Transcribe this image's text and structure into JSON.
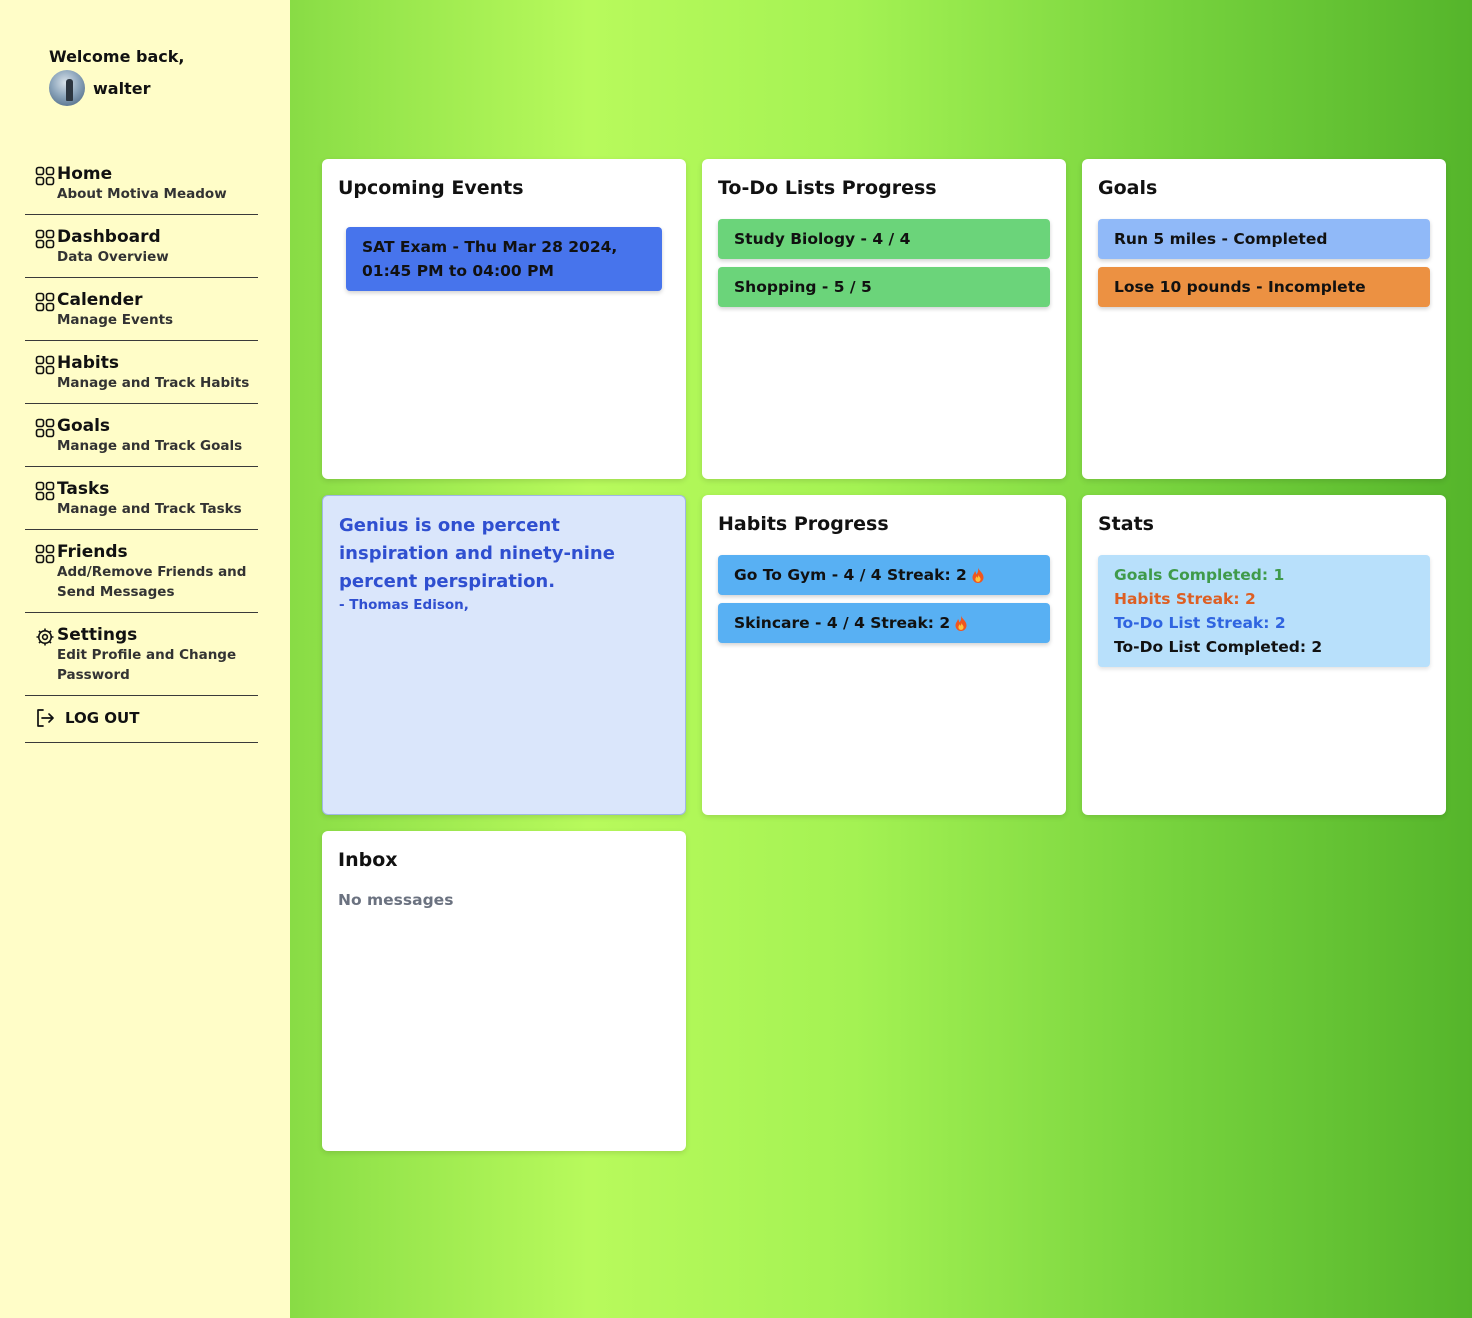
{
  "sidebar": {
    "welcome": "Welcome back,",
    "username": "walter",
    "items": [
      {
        "title": "Home",
        "subtitle": "About Motiva Meadow",
        "icon": "grid-icon"
      },
      {
        "title": "Dashboard",
        "subtitle": "Data Overview",
        "icon": "grid-icon"
      },
      {
        "title": "Calender",
        "subtitle": "Manage Events",
        "icon": "grid-icon"
      },
      {
        "title": "Habits",
        "subtitle": "Manage and Track Habits",
        "icon": "grid-icon"
      },
      {
        "title": "Goals",
        "subtitle": "Manage and Track Goals",
        "icon": "grid-icon"
      },
      {
        "title": "Tasks",
        "subtitle": "Manage and Track Tasks",
        "icon": "grid-icon"
      },
      {
        "title": "Friends",
        "subtitle": "Add/Remove Friends and Send Messages",
        "icon": "grid-icon"
      },
      {
        "title": "Settings",
        "subtitle": "Edit Profile and Change Password",
        "icon": "gear-icon"
      }
    ],
    "logout": "LOG OUT"
  },
  "events": {
    "title": "Upcoming Events",
    "items": [
      "SAT Exam - Thu Mar 28 2024, 01:45 PM to 04:00 PM"
    ]
  },
  "todo": {
    "title": "To-Do Lists Progress",
    "items": [
      "Study Biology - 4 / 4",
      "Shopping - 5 / 5"
    ]
  },
  "goals": {
    "title": "Goals",
    "items": [
      "Run 5 miles - Completed",
      "Lose 10 pounds - Incomplete"
    ]
  },
  "quote": {
    "text": "Genius is one percent inspiration and ninety-nine percent perspiration.",
    "author": "- Thomas Edison,"
  },
  "habits": {
    "title": "Habits Progress",
    "items": [
      "Go To Gym - 4 / 4 Streak: 2",
      "Skincare - 4 / 4 Streak: 2"
    ]
  },
  "stats": {
    "title": "Stats",
    "goals_completed": "Goals Completed: 1",
    "habits_streak": "Habits Streak: 2",
    "todo_streak": "To-Do List Streak: 2",
    "todo_completed": "To-Do List Completed: 2"
  },
  "inbox": {
    "title": "Inbox",
    "empty": "No messages"
  },
  "colors": {
    "sidebar_bg": "#fffdc8",
    "event_blue": "#4774ec",
    "todo_green": "#6bd47a",
    "goal_completed": "#90b9f8",
    "goal_incomplete": "#ec9142",
    "habit_blue": "#58b0f3",
    "stat_green": "#3f9a4a",
    "stat_orange": "#dd5f23",
    "stat_blue": "#2f64e0"
  }
}
